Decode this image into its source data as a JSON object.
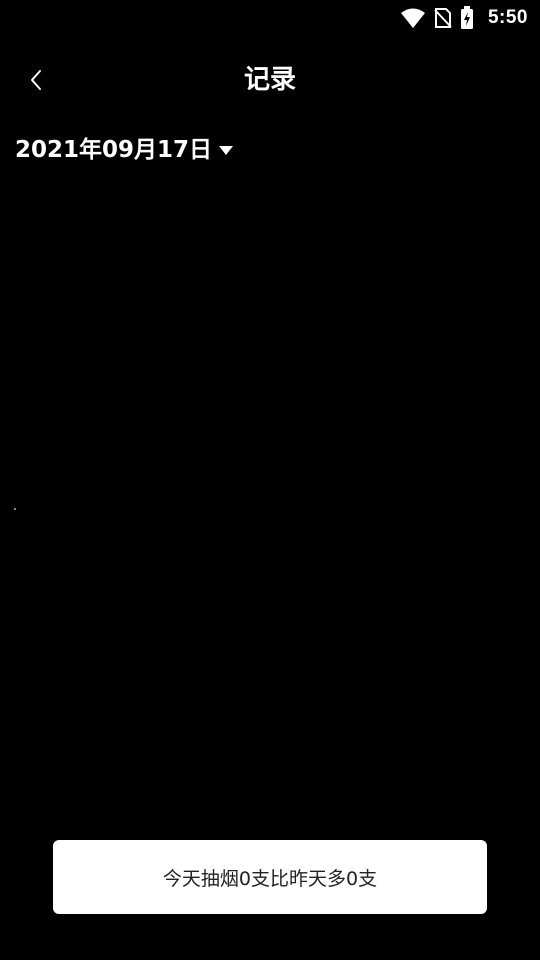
{
  "status_bar": {
    "time": "5:50",
    "icons": [
      "wifi-icon",
      "no-sim-icon",
      "battery-charging-icon"
    ]
  },
  "header": {
    "back_icon": "chevron-left-icon",
    "title": "记录"
  },
  "date_selector": {
    "date": "2021年09月17日",
    "icon": "caret-down-icon"
  },
  "summary": {
    "text": "今天抽烟0支比昨天多0支"
  },
  "colors": {
    "background": "#000000",
    "text": "#ffffff",
    "card": "#ffffff",
    "card_text": "#222222"
  }
}
